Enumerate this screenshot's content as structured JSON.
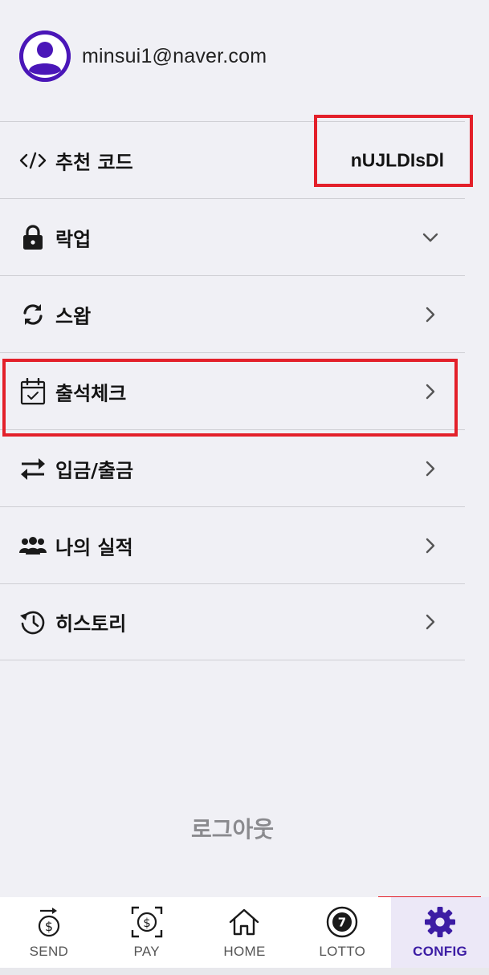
{
  "profile": {
    "email": "minsui1@naver.com",
    "avatar_icon": "user-avatar-icon"
  },
  "menu": {
    "referral": {
      "label": "추천 코드",
      "value": "nUJLDIsDl",
      "icon": "code-icon"
    },
    "lockup": {
      "label": "락업",
      "icon": "lock-icon",
      "chevron": "chevron-down-icon"
    },
    "swap": {
      "label": "스왑",
      "icon": "swap-icon",
      "chevron": "chevron-right-icon"
    },
    "attendance": {
      "label": "출석체크",
      "icon": "calendar-check-icon",
      "chevron": "chevron-right-icon"
    },
    "deposit_withdraw": {
      "label": "입금/출금",
      "icon": "transfer-arrows-icon",
      "chevron": "chevron-right-icon"
    },
    "performance": {
      "label": "나의 실적",
      "icon": "people-group-icon",
      "chevron": "chevron-right-icon"
    },
    "history": {
      "label": "히스토리",
      "icon": "history-clock-icon",
      "chevron": "chevron-right-icon"
    }
  },
  "logout_label": "로그아웃",
  "bottom_nav": {
    "items": [
      {
        "label": "SEND",
        "icon": "send-money-icon"
      },
      {
        "label": "PAY",
        "icon": "scan-pay-icon"
      },
      {
        "label": "HOME",
        "icon": "home-icon"
      },
      {
        "label": "LOTTO",
        "icon": "lotto-ball-icon",
        "ball_number": "7"
      },
      {
        "label": "CONFIG",
        "icon": "gear-icon",
        "active": true
      }
    ]
  },
  "colors": {
    "accent": "#4a16b8",
    "active_label": "#3c1ca4",
    "active_bg": "#ece8f7",
    "highlight": "#e3202a",
    "background": "#f0f0f5"
  }
}
